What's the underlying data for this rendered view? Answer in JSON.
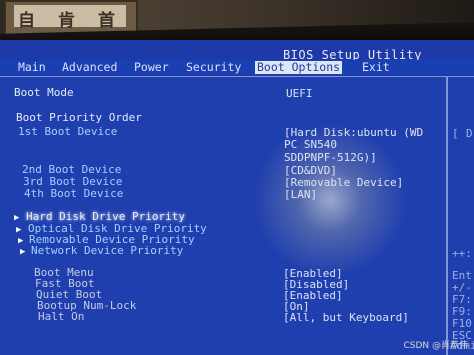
{
  "photo": {
    "wall_art_chars": [
      "自",
      "肯",
      "首"
    ]
  },
  "bios": {
    "title": "BIOS Setup Utility",
    "menu": [
      {
        "label": "Main",
        "active": false
      },
      {
        "label": "Advanced",
        "active": false
      },
      {
        "label": "Power",
        "active": false
      },
      {
        "label": "Security",
        "active": false
      },
      {
        "label": "Boot Options",
        "active": true
      },
      {
        "label": "Exit",
        "active": false
      }
    ],
    "boot_mode": {
      "label": "Boot Mode",
      "value": "UEFI"
    },
    "boot_priority_order": "Boot Priority Order",
    "boot_devices": [
      {
        "label": "1st Boot Device",
        "value_lines": [
          "[Hard Disk:ubuntu (WD",
          "PC SN540",
          "SDDPNPF-512G)]"
        ]
      },
      {
        "label": "2nd Boot Device",
        "value_lines": [
          "[CD&DVD]"
        ]
      },
      {
        "label": "3rd Boot Device",
        "value_lines": [
          "[Removable Device]"
        ]
      },
      {
        "label": "4th Boot Device",
        "value_lines": [
          "[LAN]"
        ]
      }
    ],
    "submenus": [
      "Hard Disk Drive Priority",
      "Optical Disk Drive Priority",
      "Removable Device Priority",
      "Network Device Priority"
    ],
    "options": [
      {
        "label": "Boot Menu",
        "value": "[Enabled]"
      },
      {
        "label": "Fast Boot",
        "value": "[Disabled]"
      },
      {
        "label": "Quiet Boot",
        "value": "[Enabled]"
      },
      {
        "label": "Bootup Num-Lock",
        "value": "[On]"
      },
      {
        "label": "Halt On",
        "value": "[All, but Keyboard]"
      }
    ],
    "side_help": [
      "[",
      "D",
      "++:",
      "Ent",
      "+/-",
      "F7:",
      "F9:",
      "F10",
      "ESC",
      "Admi"
    ]
  },
  "watermark": "CSDN @肖恭伟",
  "colors": {
    "screen_bg": "#1f3fae",
    "active_tab_bg": "#dfe6f3",
    "highlight_text": "#9fd1ff"
  }
}
